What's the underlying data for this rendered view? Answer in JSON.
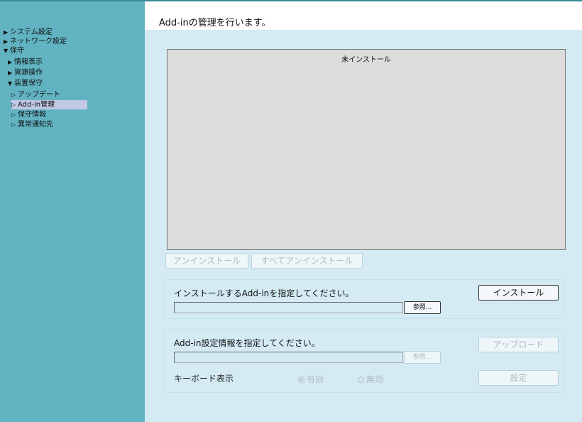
{
  "sidebar": {
    "items": [
      {
        "arrow": "▶",
        "label": "システム設定"
      },
      {
        "arrow": "▶",
        "label": "ネットワーク設定"
      },
      {
        "arrow": "▼",
        "label": "保守"
      },
      {
        "arrow": "▶",
        "label": "情報表示"
      },
      {
        "arrow": "▶",
        "label": "資源操作"
      },
      {
        "arrow": "▼",
        "label": "装置保守"
      },
      {
        "arrow": "▷",
        "label": "アップデート"
      },
      {
        "arrow": "▷",
        "label": "Add-in管理"
      },
      {
        "arrow": "▷",
        "label": "保守情報"
      },
      {
        "arrow": "▷",
        "label": "異常通知先"
      }
    ],
    "selected": "Add-in管理"
  },
  "main": {
    "title": "Add-inの管理を行います。",
    "list_header": "未インストール",
    "uninstall_button": "アンインストール",
    "uninstall_all_button": "すべてアンインストール",
    "install_panel": {
      "label": "インストールするAdd-inを指定してください。",
      "file_value": "",
      "browse_button": "参照...",
      "install_button": "インストール"
    },
    "settings_panel": {
      "label": "Add-in設定情報を指定してください。",
      "file_value": "",
      "browse_button": "参照...",
      "upload_button": "アップロード",
      "keyboard_label": "キーボード表示",
      "radio_on": "有効",
      "radio_off": "無効",
      "radio_selected": "有効",
      "set_button": "設定"
    }
  },
  "colors": {
    "sidebar_bg": "#61b3c2",
    "main_bg": "#d4ebf3",
    "selected_bg": "#c2c8e6",
    "list_bg": "#dcdcdc",
    "disabled_text": "#b0bcc0"
  }
}
